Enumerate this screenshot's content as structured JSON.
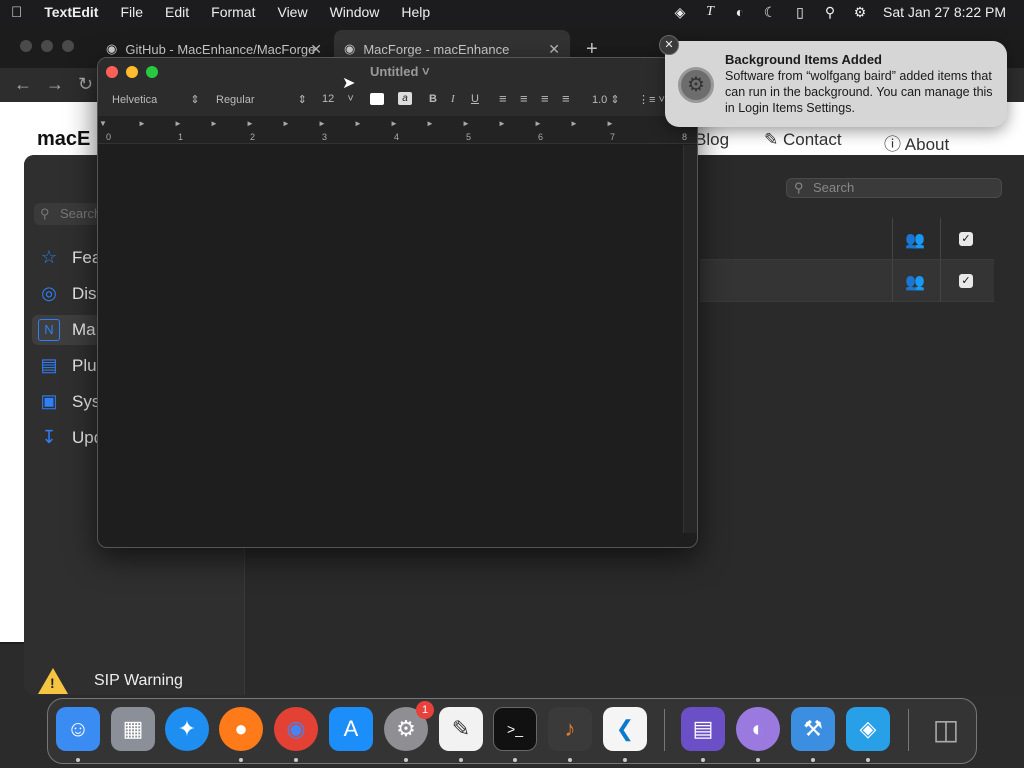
{
  "menubar": {
    "apple": "",
    "app": "TextEdit",
    "items": [
      "File",
      "Edit",
      "Format",
      "View",
      "Window",
      "Help"
    ],
    "clock": "Sat Jan 27  8:22 PM"
  },
  "browser": {
    "tabs": [
      {
        "label": "GitHub - MacEnhance/MacForge"
      },
      {
        "label": "MacForge - macEnhance"
      }
    ],
    "new_tab": "+",
    "site_logo": "macE",
    "nav": {
      "blog": "Blog",
      "contact": "Contact",
      "about": "About"
    }
  },
  "macforge": {
    "search_placeholder": "Search",
    "side_search_placeholder": "Search",
    "sidebar": [
      {
        "label": "Fea",
        "icon": "star-icon"
      },
      {
        "label": "Dis",
        "icon": "compass-icon"
      },
      {
        "label": "Ma",
        "icon": "macforge-icon"
      },
      {
        "label": "Plu",
        "icon": "plugins-icon"
      },
      {
        "label": "Sys",
        "icon": "monitor-icon"
      },
      {
        "label": "Upd",
        "icon": "download-icon"
      }
    ],
    "sip_warning": "SIP Warning"
  },
  "textedit": {
    "title": "Untitled",
    "font": "Helvetica",
    "style": "Regular",
    "size": "12",
    "spacing": "1.0",
    "ruler": [
      "0",
      "1",
      "2",
      "3",
      "4",
      "5",
      "6",
      "7",
      "8"
    ]
  },
  "notification": {
    "title": "Background Items Added",
    "body": "Software from “wolfgang baird” added items that can run in the background. You can manage this in Login Items Settings."
  },
  "dock": {
    "apps": [
      "Finder",
      "Launchpad",
      "Safari",
      "Firefox",
      "Chrome",
      "App Store",
      "System Settings",
      "TextEdit",
      "Terminal",
      "GarageBand",
      "VS Code",
      "Bluetooth Screen Sharing",
      "Disc Utility",
      "MacForge",
      "Xcode",
      "Trash"
    ],
    "settings_badge": "1"
  },
  "colors": {
    "accent": "#2f7ff7",
    "close": "#fe5f57",
    "minimize": "#febc2e",
    "zoom": "#28c840"
  }
}
